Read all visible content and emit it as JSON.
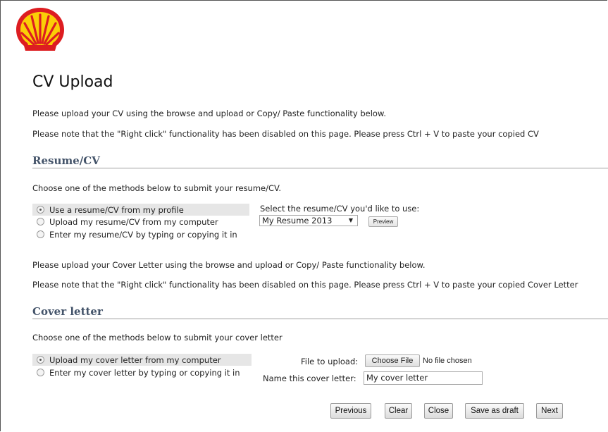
{
  "page": {
    "title": "CV Upload",
    "intro_1": "Please upload your CV using the browse and upload or Copy/ Paste functionality below.",
    "intro_2": "Please note that the \"Right click\" functionality has been disabled on this page. Please press Ctrl + V to paste your copied CV"
  },
  "resume": {
    "heading": "Resume/CV",
    "instruction": "Choose one of the methods below to submit your resume/CV.",
    "options": [
      {
        "label": "Use a resume/CV from my profile",
        "checked": true
      },
      {
        "label": "Upload my resume/CV from my computer",
        "checked": false
      },
      {
        "label": "Enter my resume/CV by typing or copying it in",
        "checked": false
      }
    ],
    "select_label": "Select the resume/CV you'd like to use:",
    "select_value": "My Resume 2013",
    "preview_label": "Preview"
  },
  "cover": {
    "intro_1": "Please upload your Cover Letter using the browse and upload or Copy/ Paste functionality below.",
    "intro_2": "Please note that the \"Right click\" functionality has been disabled on this page. Please press Ctrl + V to paste your copied Cover Letter",
    "heading": "Cover letter",
    "instruction": "Choose one of the methods below to submit your cover letter",
    "options": [
      {
        "label": "Upload my cover letter from my computer",
        "checked": true
      },
      {
        "label": "Enter my cover letter by typing or copying it in",
        "checked": false
      }
    ],
    "file_label": "File to upload:",
    "choose_file_label": "Choose File",
    "no_file_text": "No file chosen",
    "name_label": "Name this cover letter:",
    "name_value": "My cover letter"
  },
  "actions": {
    "previous": "Previous",
    "clear": "Clear",
    "close": "Close",
    "save_draft": "Save as draft",
    "next": "Next"
  },
  "icons": {
    "logo": "shell-logo-icon",
    "dropdown": "chevron-down-icon"
  },
  "colors": {
    "logo_red": "#dd1d21",
    "logo_yellow": "#fbce07",
    "section_heading": "#44546a",
    "selected_option_bg": "#e6e6e6"
  }
}
